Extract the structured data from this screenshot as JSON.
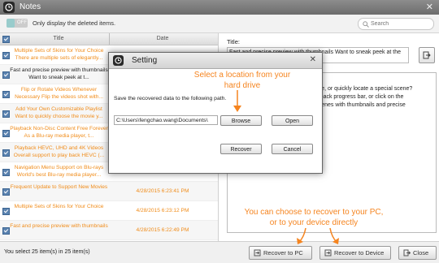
{
  "app": {
    "title": "Notes"
  },
  "toolbar": {
    "toggle_label": "OFF",
    "filter_label": "Only display the deleted items.",
    "search_placeholder": "Search"
  },
  "list": {
    "columns": [
      "Title",
      "Date"
    ],
    "rows": [
      {
        "title": "Multiple Sets of Skins for Your Choice There are multiple sets of elegantly...",
        "date": "",
        "style": "orange"
      },
      {
        "title": "Fast and precise preview with thumbnails Want to sneak peek at t...",
        "date": "",
        "style": "dark"
      },
      {
        "title": "Flip or Rotate Videos Whenever Necessary Flip the videos shot with...",
        "date": "",
        "style": "orange"
      },
      {
        "title": "Add Your Own Customizable Playlist Want to quickly choose the movie y...",
        "date": "",
        "style": "orange"
      },
      {
        "title": "Playback Non-Disc Content Free Forever As a Blu-ray media player, t...",
        "date": "",
        "style": "orange"
      },
      {
        "title": "Playback HEVC, UHD and 4K Videos Overall support to play back HEVC (...",
        "date": "",
        "style": "orange"
      },
      {
        "title": "Navigation Menu Support on Blu-rays World's best Blu-ray media player...",
        "date": "5/4/2015 12:10:56 PM",
        "style": "orange"
      },
      {
        "title": "Frequent Update to Support New Movies",
        "date": "4/28/2015 6:23:41 PM",
        "style": "orange"
      },
      {
        "title": "Multiple Sets of Skins for Your Choice",
        "date": "4/28/2015 6:23:12 PM",
        "style": "orange"
      },
      {
        "title": "Fast and precise preview with thumbnails",
        "date": "4/28/2015 6:22:49 PM",
        "style": "orange"
      }
    ]
  },
  "detail": {
    "title_label": "Title:",
    "title_value": "Fast and precise preview with thumbnails Want to sneak peek at the details",
    "content": "nails\ns movie, or quickly locate a special scene?\ne playback progress bar, or click on the\nr all scenes with thumbnails and precise"
  },
  "status": {
    "text": "You select 25 item(s) in 25 item(s)",
    "recover_pc": "Recover to PC",
    "recover_device": "Recover to Device",
    "close": "Close"
  },
  "dialog": {
    "title": "Setting",
    "path_label": "Save the recovered data to the following path.",
    "path_value": "C:\\Users\\fengchao.wang\\Documents\\",
    "browse": "Browse",
    "open": "Open",
    "recover": "Recover",
    "cancel": "Cancel"
  },
  "annotations": {
    "location_hint": "Select a location from your hard drive",
    "recover_hint": "You can choose to recover to your PC, or to your device directly",
    "color": "#f5841f"
  }
}
